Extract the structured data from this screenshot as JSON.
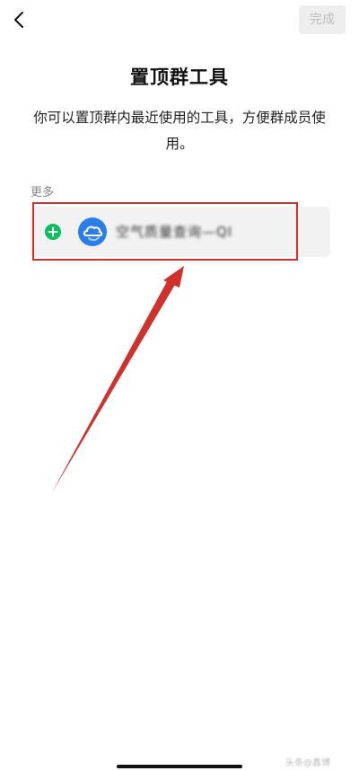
{
  "header": {
    "back_icon": "chevron-left-icon",
    "done_label": "完成"
  },
  "page": {
    "title": "置顶群工具",
    "description": "你可以置顶群内最近使用的工具，方便群成员使用。"
  },
  "more_section": {
    "label": "更多",
    "tools": [
      {
        "name": "空气质量查询—QI",
        "icon": "cloud-app-icon",
        "action_icon": "plus-circle-icon"
      }
    ]
  },
  "watermark": "头条@鑫博"
}
